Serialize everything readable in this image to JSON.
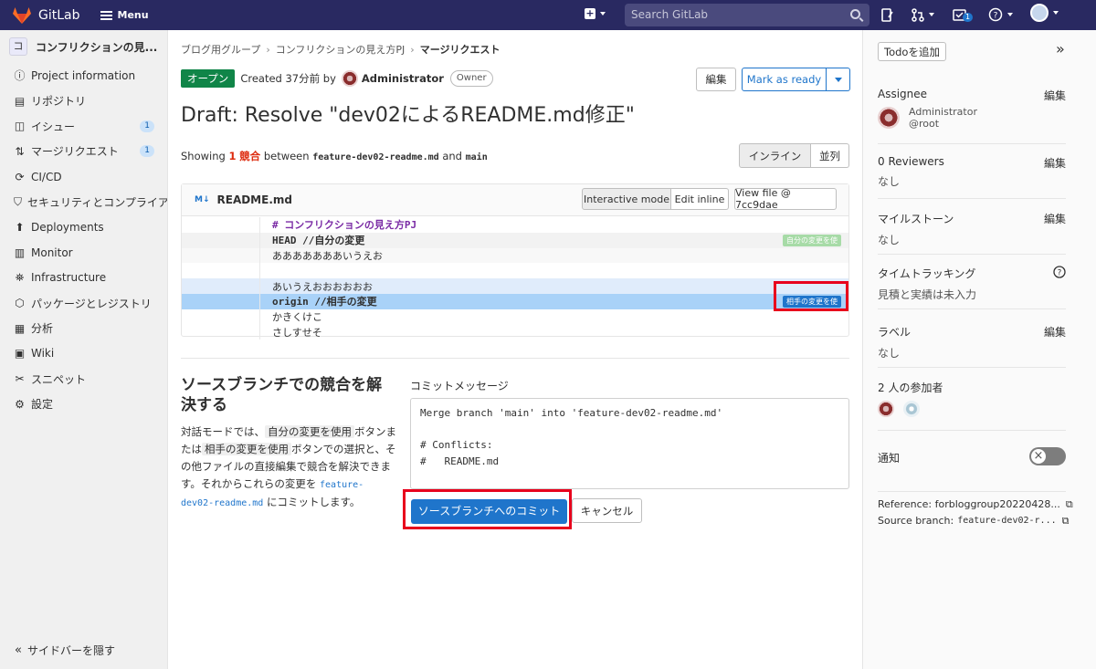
{
  "topbar": {
    "brand": "GitLab",
    "menu_label": "Menu",
    "search_placeholder": "Search GitLab",
    "todo_count": "1"
  },
  "leftnav": {
    "project_initial": "コ",
    "project_name": "コンフリクションの見...",
    "items": [
      {
        "label": "Project information",
        "badge": ""
      },
      {
        "label": "リポジトリ",
        "badge": ""
      },
      {
        "label": "イシュー",
        "badge": "1"
      },
      {
        "label": "マージリクエスト",
        "badge": "1"
      },
      {
        "label": "CI/CD",
        "badge": ""
      },
      {
        "label": "セキュリティとコンプライアンス",
        "badge": ""
      },
      {
        "label": "Deployments",
        "badge": ""
      },
      {
        "label": "Monitor",
        "badge": ""
      },
      {
        "label": "Infrastructure",
        "badge": ""
      },
      {
        "label": "パッケージとレジストリ",
        "badge": ""
      },
      {
        "label": "分析",
        "badge": ""
      },
      {
        "label": "Wiki",
        "badge": ""
      },
      {
        "label": "スニペット",
        "badge": ""
      },
      {
        "label": "設定",
        "badge": ""
      }
    ],
    "collapse_label": "サイドバーを隠す"
  },
  "breadcrumbs": [
    "ブログ用グループ",
    "コンフリクションの見え方PJ",
    "マージリクエスト"
  ],
  "mr": {
    "status": "オープン",
    "created": "Created 37分前 by",
    "author": "Administrator",
    "role": "Owner",
    "edit_label": "編集",
    "mark_ready_label": "Mark as ready",
    "title": "Draft: Resolve \"dev02によるREADME.md修正\""
  },
  "conflicts": {
    "showing_prefix": "Showing",
    "count": "1",
    "unit": "競合",
    "between": "between",
    "source": "feature-dev02-readme.md",
    "and": "and",
    "target": "main",
    "view_inline": "インライン",
    "view_parallel": "並列"
  },
  "file": {
    "name": "README.md",
    "interactive_mode": "Interactive mode",
    "edit_inline": "Edit inline",
    "view_file": "View file @ 7cc9dae",
    "lines": {
      "l1": "# コンフリクションの見え方PJ",
      "head": "HEAD //自分の変更",
      "ours1": "あああああああいうえお",
      "blank": "",
      "theirs1": "あいうえおおおおおお",
      "origin": "origin //相手の変更",
      "after1": "かきくけこ",
      "after2": "さしすせそ"
    },
    "use_ours": "自分の変更を使",
    "use_theirs": "相手の変更を使"
  },
  "resolve": {
    "heading": "ソースブランチでの競合を解決する",
    "p1": "対話モードでは、",
    "chip1": "自分の変更を使用",
    "p2": "ボタンまたは",
    "chip2": "相手の変更を使用",
    "p3": "ボタンでの選択と、その他ファイルの直接編集で競合を解決できます。それからこれらの変更を",
    "branch": "feature-dev02-readme.md",
    "p4": "にコミットします。"
  },
  "commit": {
    "label": "コミットメッセージ",
    "message": "Merge branch 'main' into 'feature-dev02-readme.md'\n\n# Conflicts:\n#   README.md",
    "submit": "ソースブランチへのコミット",
    "cancel": "キャンセル"
  },
  "rightbar": {
    "add_todo": "Todoを追加",
    "assignee_title": "Assignee",
    "edit": "編集",
    "assignee_name": "Administrator",
    "assignee_handle": "@root",
    "reviewers_title": "0 Reviewers",
    "none": "なし",
    "milestone_title": "マイルストーン",
    "time_title": "タイムトラッキング",
    "time_sub": "見積と実績は未入力",
    "label_title": "ラベル",
    "participants_title": "2 人の参加者",
    "notify_title": "通知",
    "reference": "Reference: forbloggroup20220428...",
    "source_branch_label": "Source branch:",
    "source_branch": "feature-dev02-r..."
  },
  "colors": {
    "topbar": "#292961",
    "accent": "#1f75cb",
    "open": "#108548",
    "highlight": "#e8001c"
  }
}
